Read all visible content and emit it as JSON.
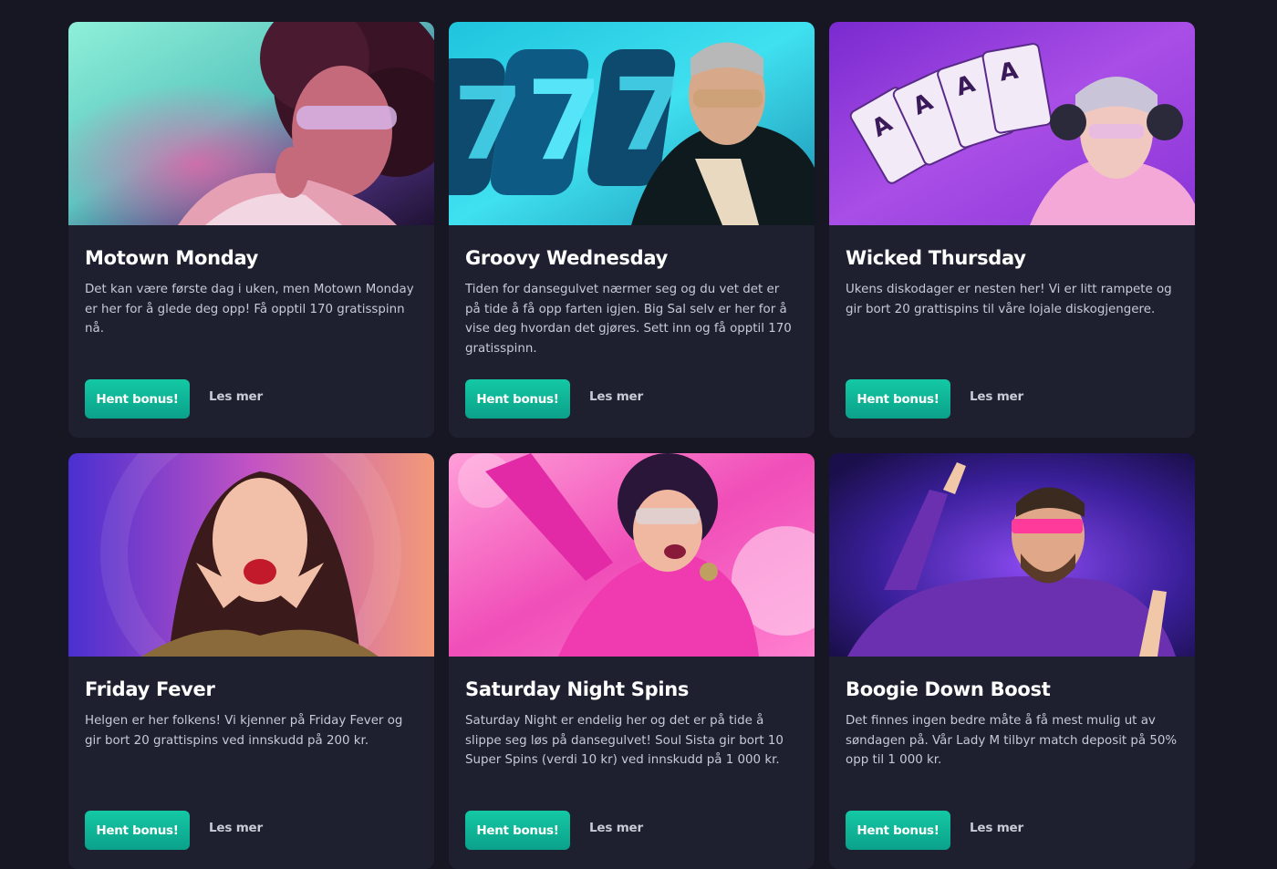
{
  "cards": [
    {
      "title": "Motown Monday",
      "description": "Det kan være første dag i uken, men Motown Monday er her for å glede deg opp! Få opptil 170 gratisspinn nå.",
      "button_label": "Hent bonus!",
      "link_label": "Les mer",
      "image": "woman-afro-sunglasses-illustration",
      "colors": [
        "#6fd8c4",
        "#b0367a",
        "#3b1d4a"
      ]
    },
    {
      "title": "Groovy Wednesday",
      "description": "Tiden for dansegulvet nærmer seg og du vet det er på tide å få opp farten igjen. Big Sal selv er her for å vise deg hvordan det gjøres. Sett inn og få opptil 170 gratisspinn.",
      "button_label": "Hent bonus!",
      "link_label": "Les mer",
      "image": "man-sunglasses-slot-777-illustration",
      "colors": [
        "#2fd6e8",
        "#0d6f9a",
        "#0b2a3a"
      ]
    },
    {
      "title": "Wicked Thursday",
      "description": "Ukens diskodager er nesten her! Vi er litt rampete og gir bort 20 grattispins til våre lojale diskogjengere.",
      "button_label": "Hent bonus!",
      "link_label": "Les mer",
      "image": "woman-headphones-aces-illustration",
      "colors": [
        "#9b3fd6",
        "#c766e0",
        "#6a1fb0"
      ]
    },
    {
      "title": "Friday Fever",
      "description": "Helgen er her folkens! Vi kjenner på Friday Fever og gir bort 20 grattispins ved innskudd på 200 kr.",
      "button_label": "Hent bonus!",
      "link_label": "Les mer",
      "image": "excited-woman-photo",
      "colors": [
        "#5a3ad8",
        "#e06aa8",
        "#f5a070"
      ]
    },
    {
      "title": "Saturday Night Spins",
      "description": "Saturday Night er endelig her og det er på tide å slippe seg løs på dansegulvet! Soul Sista gir bort 10 Super Spins (verdi 10 kr) ved innskudd på 1 000 kr.",
      "button_label": "Hent bonus!",
      "link_label": "Les mer",
      "image": "dancing-woman-disco-illustration",
      "colors": [
        "#ff6fc8",
        "#e03aa8",
        "#ffd0ec"
      ]
    },
    {
      "title": "Boogie Down Boost",
      "description": "Det finnes ingen bedre måte å få mest mulig ut av søndagen på. Vår Lady M tilbyr match deposit på 50% opp til 1 000 kr.",
      "button_label": "Hent bonus!",
      "link_label": "Les mer",
      "image": "dancing-man-purple-sweater-photo",
      "colors": [
        "#2a1a6a",
        "#7a3ad8",
        "#ff3a90"
      ]
    }
  ]
}
